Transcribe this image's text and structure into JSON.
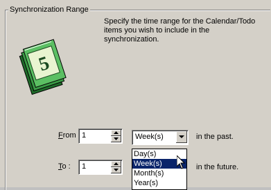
{
  "group": {
    "title": "Synchronization Range"
  },
  "description": "Specify the time range for the Calendar/Todo items you wish to include in the synchronization.",
  "from": {
    "label_accel": "F",
    "label_rest": "rom :",
    "value": "1",
    "unit": "Week(s)",
    "suffix": "in the past."
  },
  "to": {
    "label_accel": "T",
    "label_rest": "o :",
    "value": "1",
    "suffix": "in the future."
  },
  "dropdown": {
    "options": [
      "Day(s)",
      "Week(s)",
      "Month(s)",
      "Year(s)"
    ],
    "selected_index": 1
  },
  "icons": {
    "calendar": "calendar-money-icon",
    "spin_up": "up-arrow-icon",
    "spin_down": "down-arrow-icon",
    "combo_arrow": "chevron-down-icon",
    "cursor": "mouse-pointer-icon"
  },
  "colors": {
    "face": "#d4d0c8",
    "highlight": "#0a246a",
    "money": "#2f8f3a"
  }
}
